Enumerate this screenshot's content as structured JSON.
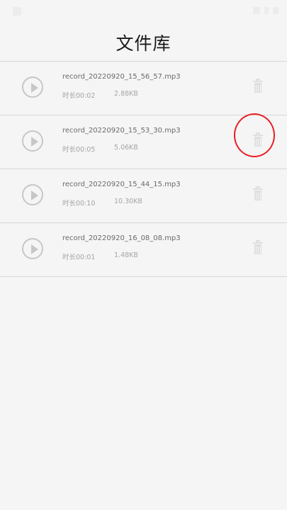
{
  "header": {
    "title": "文件库"
  },
  "files": [
    {
      "name": "record_20220920_15_56_57.mp3",
      "duration": "时长00:02",
      "size": "2.88KB"
    },
    {
      "name": "record_20220920_15_53_30.mp3",
      "duration": "时长00:05",
      "size": "5.06KB"
    },
    {
      "name": "record_20220920_15_44_15.mp3",
      "duration": "时长00:10",
      "size": "10.30KB"
    },
    {
      "name": "record_20220920_16_08_08.mp3",
      "duration": "时长00:01",
      "size": "1.48KB"
    }
  ],
  "colors": {
    "highlight": "#ea1e25",
    "background": "#f5f5f5"
  },
  "icons": {
    "play": "play-circle-icon",
    "delete": "trash-icon"
  }
}
